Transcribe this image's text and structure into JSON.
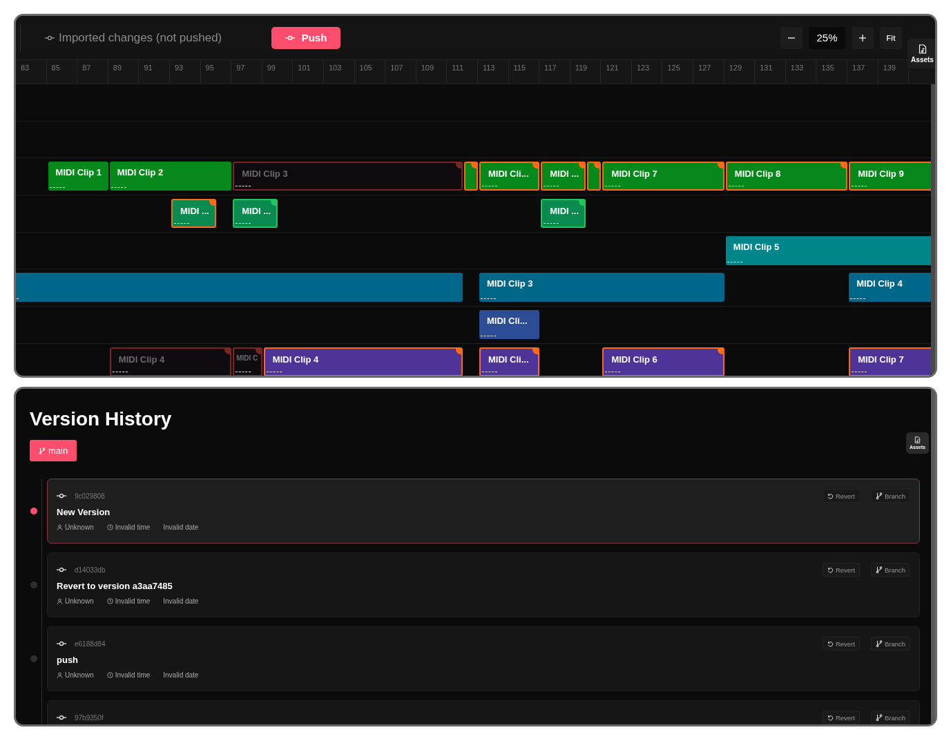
{
  "toolbar": {
    "status": "Imported changes (not pushed)",
    "push_button": "Push",
    "zoom": "25%",
    "fit": "Fit",
    "assets": "Assets"
  },
  "ruler": [
    "83",
    "85",
    "87",
    "89",
    "91",
    "93",
    "95",
    "97",
    "99",
    "101",
    "103",
    "105",
    "107",
    "109",
    "111",
    "113",
    "115",
    "117",
    "119",
    "121",
    "123",
    "125",
    "127",
    "129",
    "131",
    "133",
    "135",
    "137",
    "139"
  ],
  "tracks": [
    {
      "clips": [
        {
          "title": "MIDI Clip 1",
          "color": "#06891a",
          "kind": "unchanged"
        },
        {
          "title": "MIDI Clip 2",
          "color": "#06891a",
          "kind": "unchanged"
        },
        {
          "title": "MIDI Clip 3",
          "kind": "deleted"
        },
        {
          "color": "#06891a",
          "kind": "modified"
        },
        {
          "title": "MIDI Cli...",
          "color": "#06891a",
          "kind": "modified"
        },
        {
          "title": "MIDI ...",
          "color": "#06891a",
          "kind": "modified"
        },
        {
          "color": "#06891a",
          "kind": "modified"
        },
        {
          "title": "MIDI Clip 7",
          "color": "#06891a",
          "kind": "modified"
        },
        {
          "title": "MIDI Clip 8",
          "color": "#06891a",
          "kind": "modified"
        },
        {
          "title": "MIDI Clip 9",
          "color": "#06891a",
          "kind": "modified"
        }
      ]
    },
    {
      "clips": [
        {
          "title": "MIDI ...",
          "color": "#0b8a50",
          "kind": "modified"
        },
        {
          "title": "MIDI ...",
          "color": "#0b8a50",
          "kind": "added"
        },
        {
          "title": "MIDI ...",
          "color": "#0b8a50",
          "kind": "added"
        }
      ]
    },
    {
      "clips": [
        {
          "title": "MIDI Clip 5",
          "color": "#00868a",
          "kind": "unchanged"
        }
      ]
    },
    {
      "clips": [
        {
          "color": "#00678a",
          "kind": "unchanged"
        },
        {
          "title": "MIDI Clip 3",
          "color": "#00678a",
          "kind": "unchanged"
        },
        {
          "title": "MIDI Clip 4",
          "color": "#00678a",
          "kind": "unchanged"
        }
      ]
    },
    {
      "clips": [
        {
          "title": "MIDI Cli...",
          "color": "#2d4c96",
          "kind": "unchanged"
        }
      ]
    },
    {
      "clips": [
        {
          "title": "MIDI Clip 4",
          "kind": "deleted"
        },
        {
          "title": "MIDI C",
          "kind": "deleted"
        },
        {
          "title": "MIDI Clip 4",
          "color": "#4e3399",
          "kind": "modified"
        },
        {
          "title": "MIDI Cli...",
          "color": "#4e3399",
          "kind": "modified"
        },
        {
          "title": "MIDI Clip 6",
          "color": "#4e3399",
          "kind": "modified"
        },
        {
          "title": "MIDI Clip 7",
          "color": "#4e3399",
          "kind": "modified"
        }
      ]
    }
  ],
  "version_history": {
    "title": "Version History",
    "branch": "main",
    "assets": "Assets",
    "commits": [
      {
        "hash": "9c029808",
        "message": "New Version",
        "author": "Unknown",
        "time": "Invalid time",
        "date": "Invalid date",
        "selected": true,
        "revert": "Revert",
        "branch": "Branch"
      },
      {
        "hash": "d14033db",
        "message": "Revert to version a3aa7485",
        "author": "Unknown",
        "time": "Invalid time",
        "date": "Invalid date",
        "selected": false,
        "revert": "Revert",
        "branch": "Branch"
      },
      {
        "hash": "e6188d84",
        "message": "push",
        "author": "Unknown",
        "time": "Invalid time",
        "date": "Invalid date",
        "selected": false,
        "revert": "Revert",
        "branch": "Branch"
      },
      {
        "hash": "97b9350f",
        "selected": false,
        "revert": "Revert",
        "branch": "Branch"
      }
    ]
  }
}
